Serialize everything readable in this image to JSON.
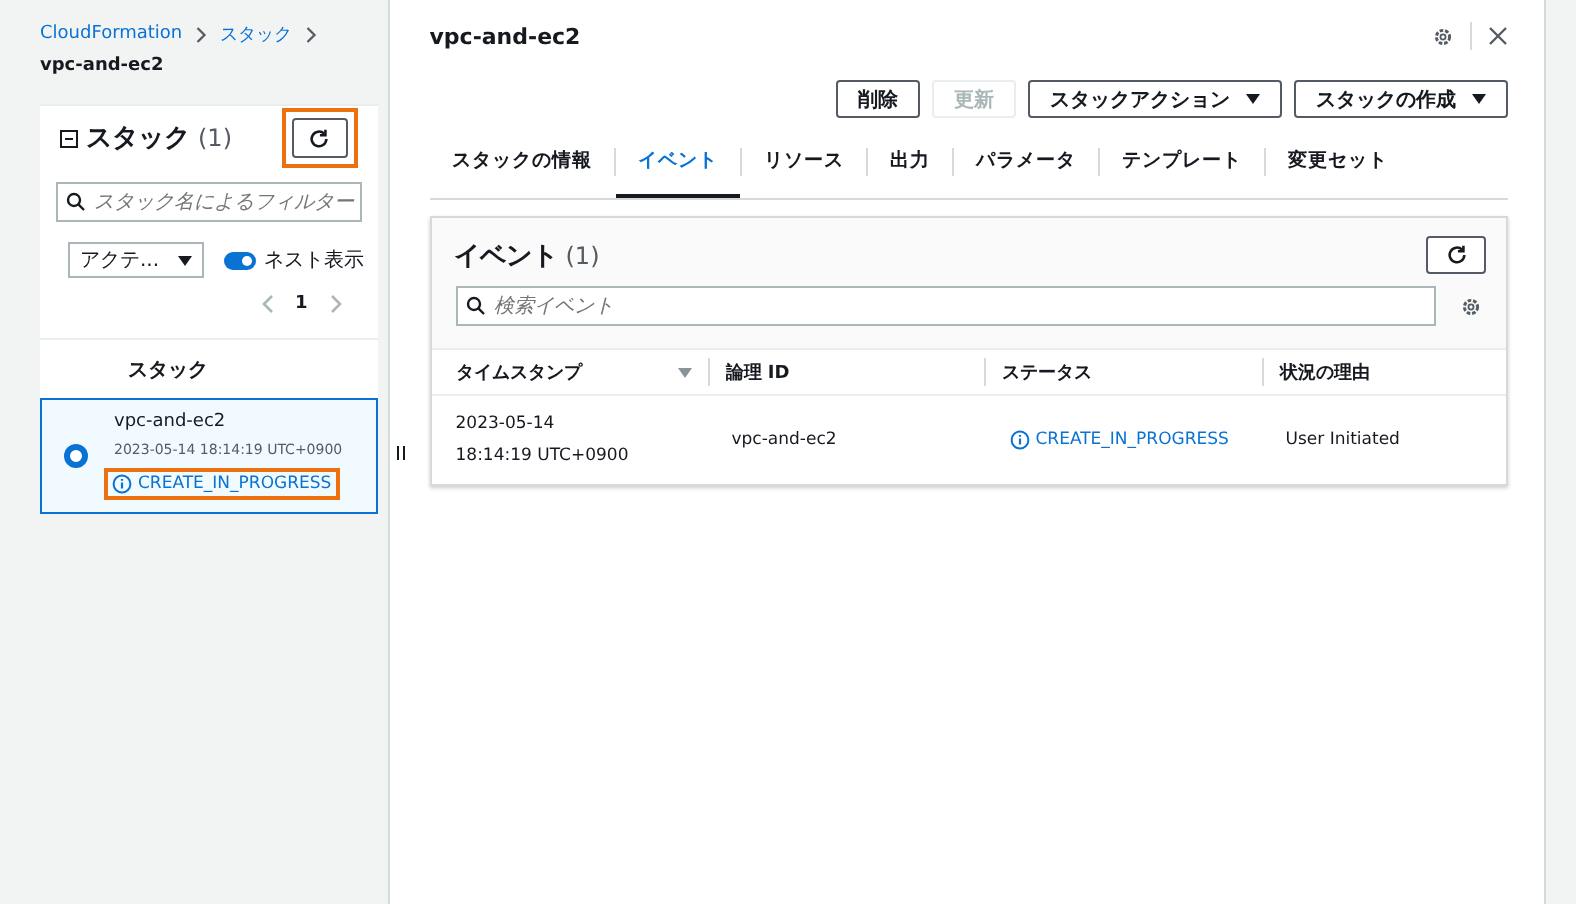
{
  "breadcrumb": {
    "items": [
      "CloudFormation",
      "スタック"
    ],
    "current": "vpc-and-ec2"
  },
  "stack_list": {
    "title": "スタック",
    "count": "(1)",
    "refresh_highlighted": true,
    "filter_placeholder": "スタック名によるフィルター",
    "status_filter": "アクテ...",
    "nested_toggle": {
      "label": "ネスト表示",
      "on": true
    },
    "page": "1",
    "column": "スタック",
    "rows": [
      {
        "name": "vpc-and-ec2",
        "time": "2023-05-14 18:14:19 UTC+0900",
        "status": "CREATE_IN_PROGRESS",
        "selected": true,
        "status_highlighted": true
      }
    ]
  },
  "detail": {
    "title": "vpc-and-ec2",
    "buttons": [
      {
        "label": "削除",
        "disabled": false,
        "dropdown": false
      },
      {
        "label": "更新",
        "disabled": true,
        "dropdown": false
      },
      {
        "label": "スタックアクション",
        "disabled": false,
        "dropdown": true
      },
      {
        "label": "スタックの作成",
        "disabled": false,
        "dropdown": true
      }
    ],
    "tabs": [
      {
        "label": "スタックの情報",
        "selected": false
      },
      {
        "label": "イベント",
        "selected": true
      },
      {
        "label": "リソース",
        "selected": false
      },
      {
        "label": "出力",
        "selected": false
      },
      {
        "label": "パラメータ",
        "selected": false
      },
      {
        "label": "テンプレート",
        "selected": false
      },
      {
        "label": "変更セット",
        "selected": false
      }
    ],
    "events": {
      "title": "イベント",
      "count": "(1)",
      "search_placeholder": "検索イベント",
      "columns": [
        "タイムスタンプ",
        "論理 ID",
        "ステータス",
        "状況の理由"
      ],
      "rows": [
        {
          "timestamp": "2023-05-14 18:14:19 UTC+0900",
          "logical_id": "vpc-and-ec2",
          "status": "CREATE_IN_PROGRESS",
          "reason": "User Initiated"
        }
      ]
    }
  }
}
